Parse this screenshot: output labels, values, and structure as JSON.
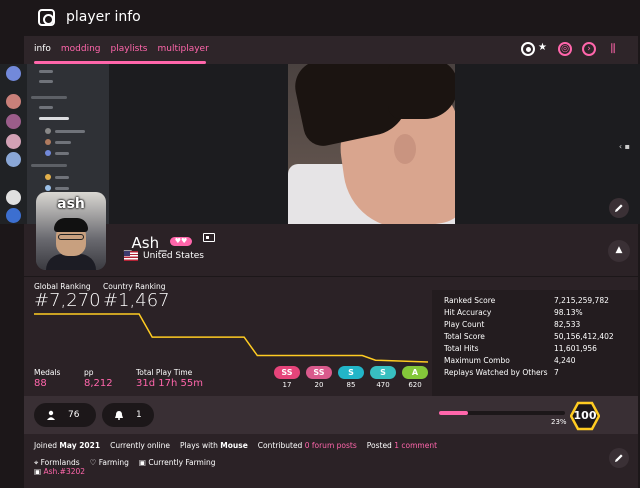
{
  "app": {
    "title": "player info"
  },
  "nav": {
    "tabs": [
      {
        "label": "info"
      },
      {
        "label": "modding"
      },
      {
        "label": "playlists"
      },
      {
        "label": "multiplayer"
      }
    ],
    "modes": [
      "osu-mode-icon",
      "star-icon",
      "taiko-mode-icon",
      "catch-mode-icon",
      "mania-mode-icon"
    ],
    "accent": "#ff66ab"
  },
  "avatar": {
    "label": "ash"
  },
  "user": {
    "name": "_Ash_",
    "supporter": "♥♥",
    "country": "United States"
  },
  "ranking": {
    "global_label": "Global Ranking",
    "global_value": "#7,270",
    "country_label": "Country Ranking",
    "country_value": "#1,467"
  },
  "chart_data": {
    "type": "line",
    "x": [
      0,
      8,
      9,
      16,
      17,
      25,
      26,
      30
    ],
    "values": [
      -3,
      -3,
      -5.5,
      -5.5,
      -7.5,
      -7.5,
      -8,
      -8.2
    ],
    "title": "",
    "xlabel": "",
    "ylabel": "",
    "color": "#ffcc22"
  },
  "summary": {
    "medals_label": "Medals",
    "medals_value": "88",
    "pp_label": "pp",
    "pp_value": "8,212",
    "playtime_label": "Total Play Time",
    "playtime_value": "31d 17h 55m"
  },
  "grades": [
    {
      "label": "SS",
      "count": "17",
      "color": "#e6447a"
    },
    {
      "label": "SS",
      "count": "20",
      "color": "#d95a8c"
    },
    {
      "label": "S",
      "count": "85",
      "color": "#22b5c8"
    },
    {
      "label": "S",
      "count": "470",
      "color": "#38bfc0"
    },
    {
      "label": "A",
      "count": "620",
      "color": "#84c83a"
    }
  ],
  "side_stats": [
    {
      "k": "Ranked Score",
      "v": "7,215,259,782"
    },
    {
      "k": "Hit Accuracy",
      "v": "98.13%"
    },
    {
      "k": "Play Count",
      "v": "82,533"
    },
    {
      "k": "Total Score",
      "v": "50,156,412,402"
    },
    {
      "k": "Total Hits",
      "v": "11,601,956"
    },
    {
      "k": "Maximum Combo",
      "v": "4,240"
    },
    {
      "k": "Replays Watched by Others",
      "v": "7"
    }
  ],
  "social": {
    "followers": "76",
    "mapping_subs": "1"
  },
  "level": {
    "value": "100",
    "progress": 0.23,
    "progress_label": "23%"
  },
  "info": {
    "joined_prefix": "Joined",
    "joined": "May 2021",
    "online": "Currently online",
    "plays_prefix": "Plays with",
    "plays_with": "Mouse",
    "contrib_prefix": "Contributed",
    "contrib": "0 forum posts",
    "posted_prefix": "Posted",
    "posted": "1 comment",
    "location": "Formlands",
    "interests": "Farming",
    "occupation": "Currently Farming",
    "discord": "Ash.#3202"
  }
}
